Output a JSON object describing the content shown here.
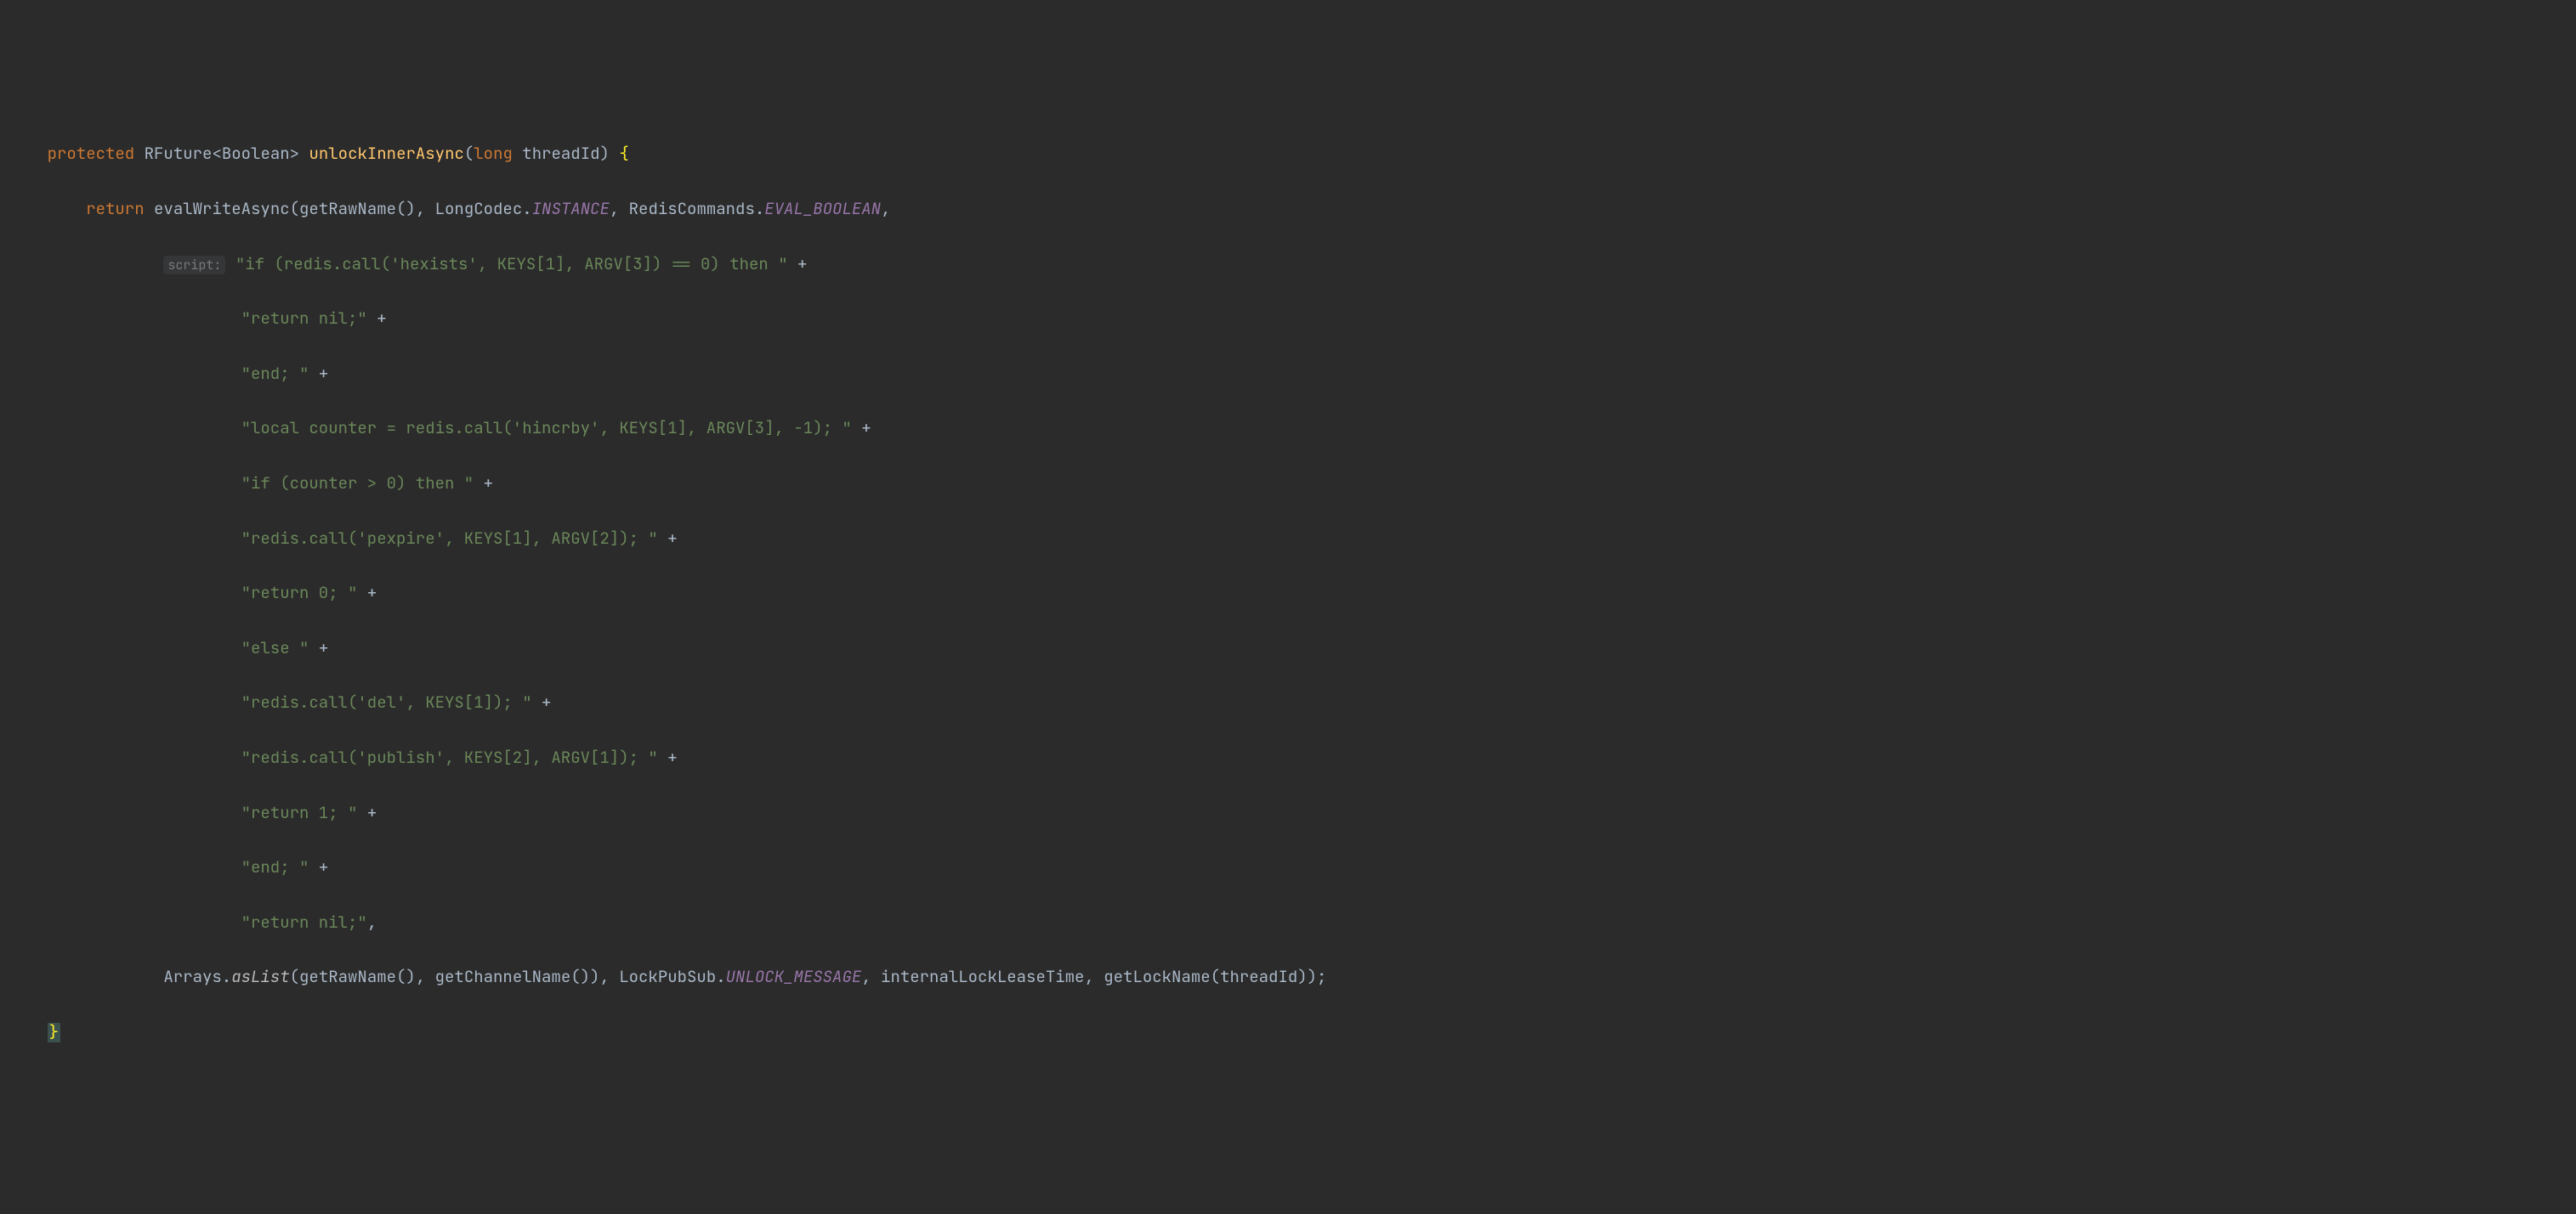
{
  "code": {
    "l1_protected": "protected",
    "l1_rfuture": "RFuture",
    "l1_lt": "<",
    "l1_boolean": "Boolean",
    "l1_gt": ">",
    "l1_method": "unlockInnerAsync",
    "l1_open": "(",
    "l1_long": "long",
    "l1_param": "threadId",
    "l1_close": ")",
    "l1_brace": "{",
    "l2_return": "return",
    "l2_eval": "evalWriteAsync",
    "l2_p1": "(getRawName(), LongCodec.",
    "l2_instance": "INSTANCE",
    "l2_p2": ", RedisCommands.",
    "l2_evalb": "EVAL_BOOLEAN",
    "l2_p3": ",",
    "hint_script": "script:",
    "s1": "\"if (redis.call('hexists', KEYS[1], ARGV[3]) == 0) then \"",
    "s2": "\"return nil;\"",
    "s3": "\"end; \"",
    "s4": "\"local counter = redis.call('hincrby', KEYS[1], ARGV[3], -1); \"",
    "s5": "\"if (counter > 0) then \"",
    "s6": "\"redis.call('pexpire', KEYS[1], ARGV[2]); \"",
    "s7": "\"return 0; \"",
    "s8": "\"else \"",
    "s9": "\"redis.call('del', KEYS[1]); \"",
    "s10": "\"redis.call('publish', KEYS[2], ARGV[1]); \"",
    "s11": "\"return 1; \"",
    "s12": "\"end; \"",
    "s13": "\"return nil;\"",
    "plus": " +",
    "comma": ",",
    "l16_a": "Arrays.",
    "l16_aslist": "asList",
    "l16_b": "(getRawName(), getChannelName()), LockPubSub.",
    "l16_unlock": "UNLOCK_MESSAGE",
    "l16_c": ", internalLockLeaseTime, getLockName(threadId));",
    "l17_brace": "}"
  }
}
